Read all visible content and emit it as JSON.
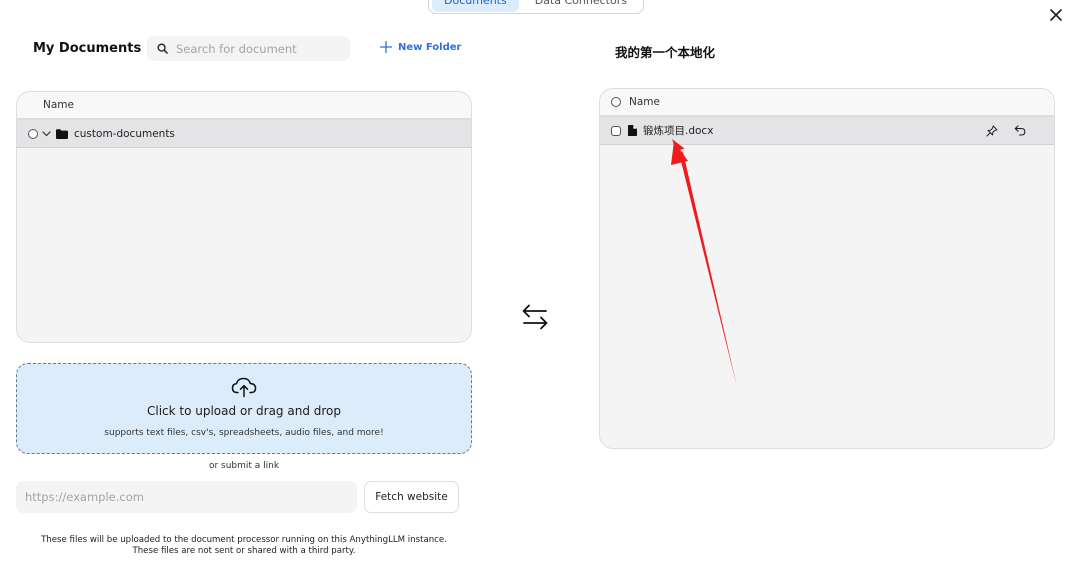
{
  "top_tabs": [
    {
      "label": "Documents",
      "active": true
    },
    {
      "label": "Data Connectors",
      "active": false
    }
  ],
  "close": {
    "icon": "close-icon"
  },
  "left": {
    "title": "My Documents",
    "search": {
      "placeholder": "Search for document",
      "value": "",
      "icon": "search-icon"
    },
    "new_folder_label": "New Folder",
    "table": {
      "header": "Name",
      "rows": [
        {
          "name": "custom-documents",
          "type": "folder",
          "expanded": true
        }
      ]
    }
  },
  "upload": {
    "icon": "cloud-upload-icon",
    "title": "Click to upload or drag and drop",
    "subtitle": "supports text files, csv's, spreadsheets, audio files, and more!"
  },
  "link": {
    "or_label": "or submit a link",
    "url_placeholder": "https://example.com",
    "fetch_label": "Fetch website"
  },
  "disclaimer": {
    "line1": "These files will be uploaded to the document processor running on this AnythingLLM instance.",
    "line2": "These files are not sent or shared with a third party."
  },
  "swap": {
    "icon": "swap-arrows-icon"
  },
  "right": {
    "title": "我的第一个本地化",
    "table": {
      "header": "Name",
      "rows": [
        {
          "name": "锻炼项目.docx",
          "type": "file",
          "actions": [
            "pin-icon",
            "undo-icon"
          ]
        }
      ]
    }
  },
  "colors": {
    "accent": "#2f6fe0",
    "upload_bg": "#dcecfb",
    "annotation_arrow": "#ee1c1c"
  }
}
